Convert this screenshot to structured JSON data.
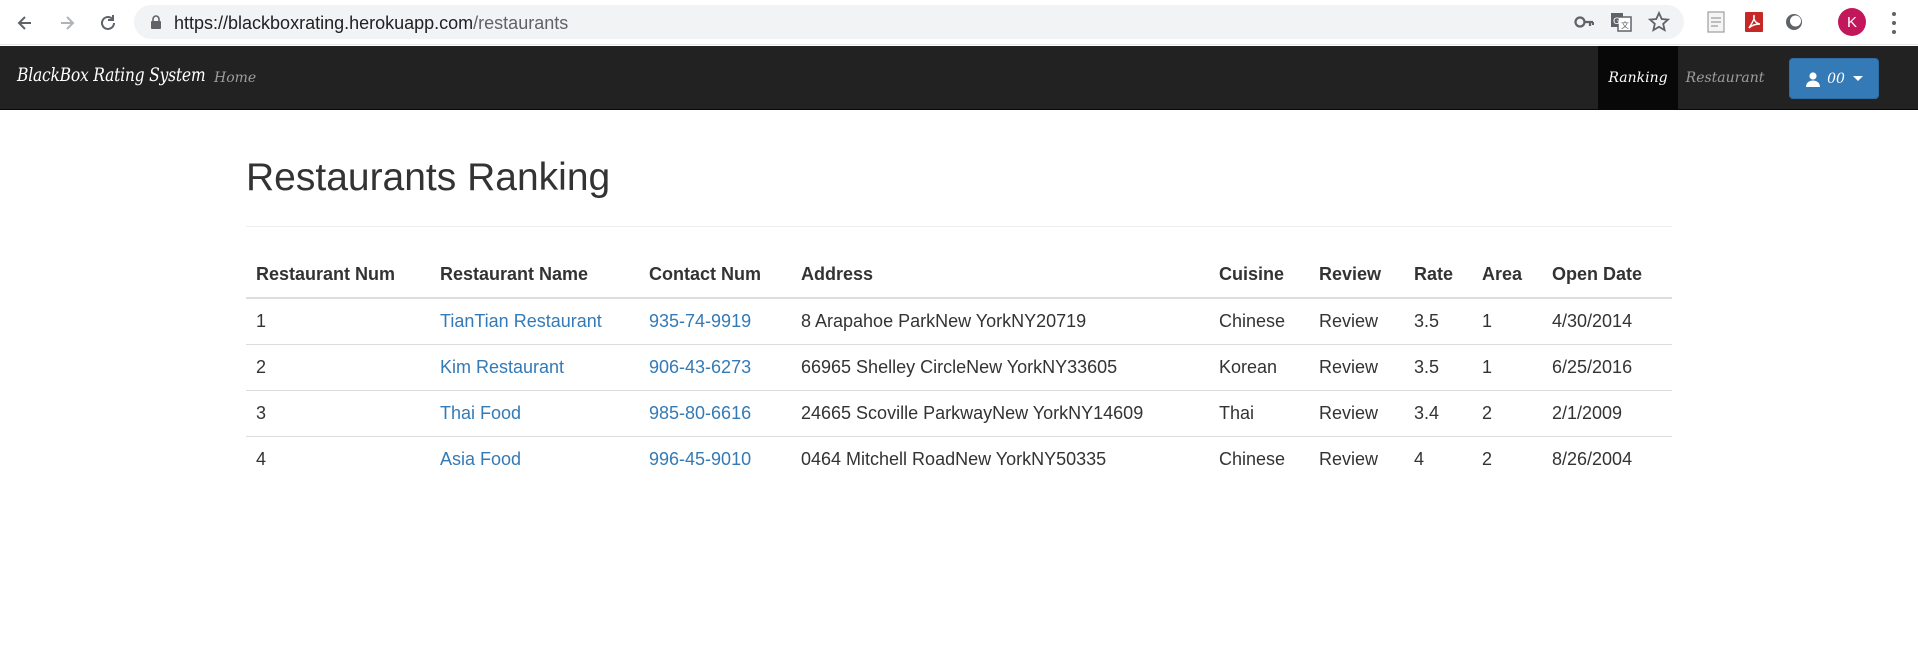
{
  "browser": {
    "url_host": "https://blackboxrating.herokuapp.com",
    "url_path": "/restaurants",
    "profile_initial": "K"
  },
  "navbar": {
    "brand": "BlackBox Rating System",
    "home": "Home",
    "ranking": "Ranking",
    "restaurant": "Restaurant",
    "user": "00"
  },
  "page": {
    "title": "Restaurants Ranking"
  },
  "table": {
    "headers": [
      "Restaurant Num",
      "Restaurant Name",
      "Contact Num",
      "Address",
      "Cuisine",
      "Review",
      "Rate",
      "Area",
      "Open Date"
    ],
    "rows": [
      {
        "num": "1",
        "name": "TianTian Restaurant",
        "contact": "935-74-9919",
        "address": "8 Arapahoe ParkNew YorkNY20719",
        "cuisine": "Chinese",
        "review": "Review",
        "rate": "3.5",
        "area": "1",
        "open_date": "4/30/2014"
      },
      {
        "num": "2",
        "name": "Kim Restaurant",
        "contact": "906-43-6273",
        "address": "66965 Shelley CircleNew YorkNY33605",
        "cuisine": "Korean",
        "review": "Review",
        "rate": "3.5",
        "area": "1",
        "open_date": "6/25/2016"
      },
      {
        "num": "3",
        "name": "Thai Food",
        "contact": "985-80-6616",
        "address": "24665 Scoville ParkwayNew YorkNY14609",
        "cuisine": "Thai",
        "review": "Review",
        "rate": "3.4",
        "area": "2",
        "open_date": "2/1/2009"
      },
      {
        "num": "4",
        "name": "Asia Food",
        "contact": "996-45-9010",
        "address": "0464 Mitchell RoadNew YorkNY50335",
        "cuisine": "Chinese",
        "review": "Review",
        "rate": "4",
        "area": "2",
        "open_date": "8/26/2004"
      }
    ]
  },
  "colors": {
    "navbar_bg": "#222222",
    "navbar_active_bg": "#080808",
    "link": "#337ab7",
    "user_button": "#337ab7",
    "avatar": "#c2185b"
  }
}
